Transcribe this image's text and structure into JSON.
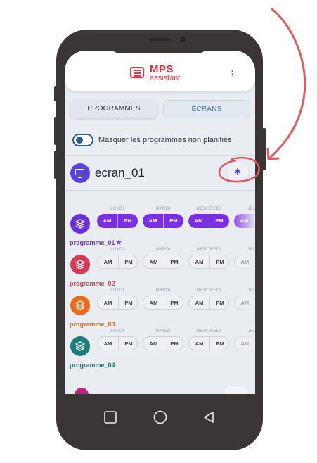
{
  "app": {
    "logo_main": "MPS",
    "logo_sub": "assistant",
    "menu_icon": "kebab-menu-icon"
  },
  "tabs": [
    {
      "label": "PROGRAMMES"
    },
    {
      "label": "ÉCRANS"
    }
  ],
  "filter": {
    "label": "Masquer les programmes non planifiés",
    "enabled": true
  },
  "ecran": {
    "name": "ecran_01",
    "icon": "monitor-icon",
    "settings_icon": "gear-icon"
  },
  "days": [
    "LUNDI",
    "MARDI",
    "MERCREDI",
    "JEUDI"
  ],
  "slot_labels": {
    "am": "AM",
    "pm": "PM"
  },
  "programmes": [
    {
      "name": "programme_01",
      "color": "#6b2fe0",
      "favorite": true,
      "scheduled": [
        true,
        true,
        true,
        true
      ]
    },
    {
      "name": "programme_02",
      "color": "#d63a56",
      "favorite": false,
      "scheduled": [
        false,
        false,
        false,
        false
      ]
    },
    {
      "name": "programme_03",
      "color": "#ef6a16",
      "favorite": false,
      "scheduled": [
        false,
        false,
        false,
        false
      ]
    },
    {
      "name": "programme_04",
      "color": "#1b7d7a",
      "favorite": false,
      "scheduled": [
        false,
        false,
        false,
        false
      ]
    }
  ],
  "colors": {
    "accent": "#5a3ee6",
    "brand_red": "#d8343f",
    "annotation": "#e05a5f"
  },
  "device_nav": [
    "square-icon",
    "circle-icon",
    "back-triangle-icon"
  ]
}
